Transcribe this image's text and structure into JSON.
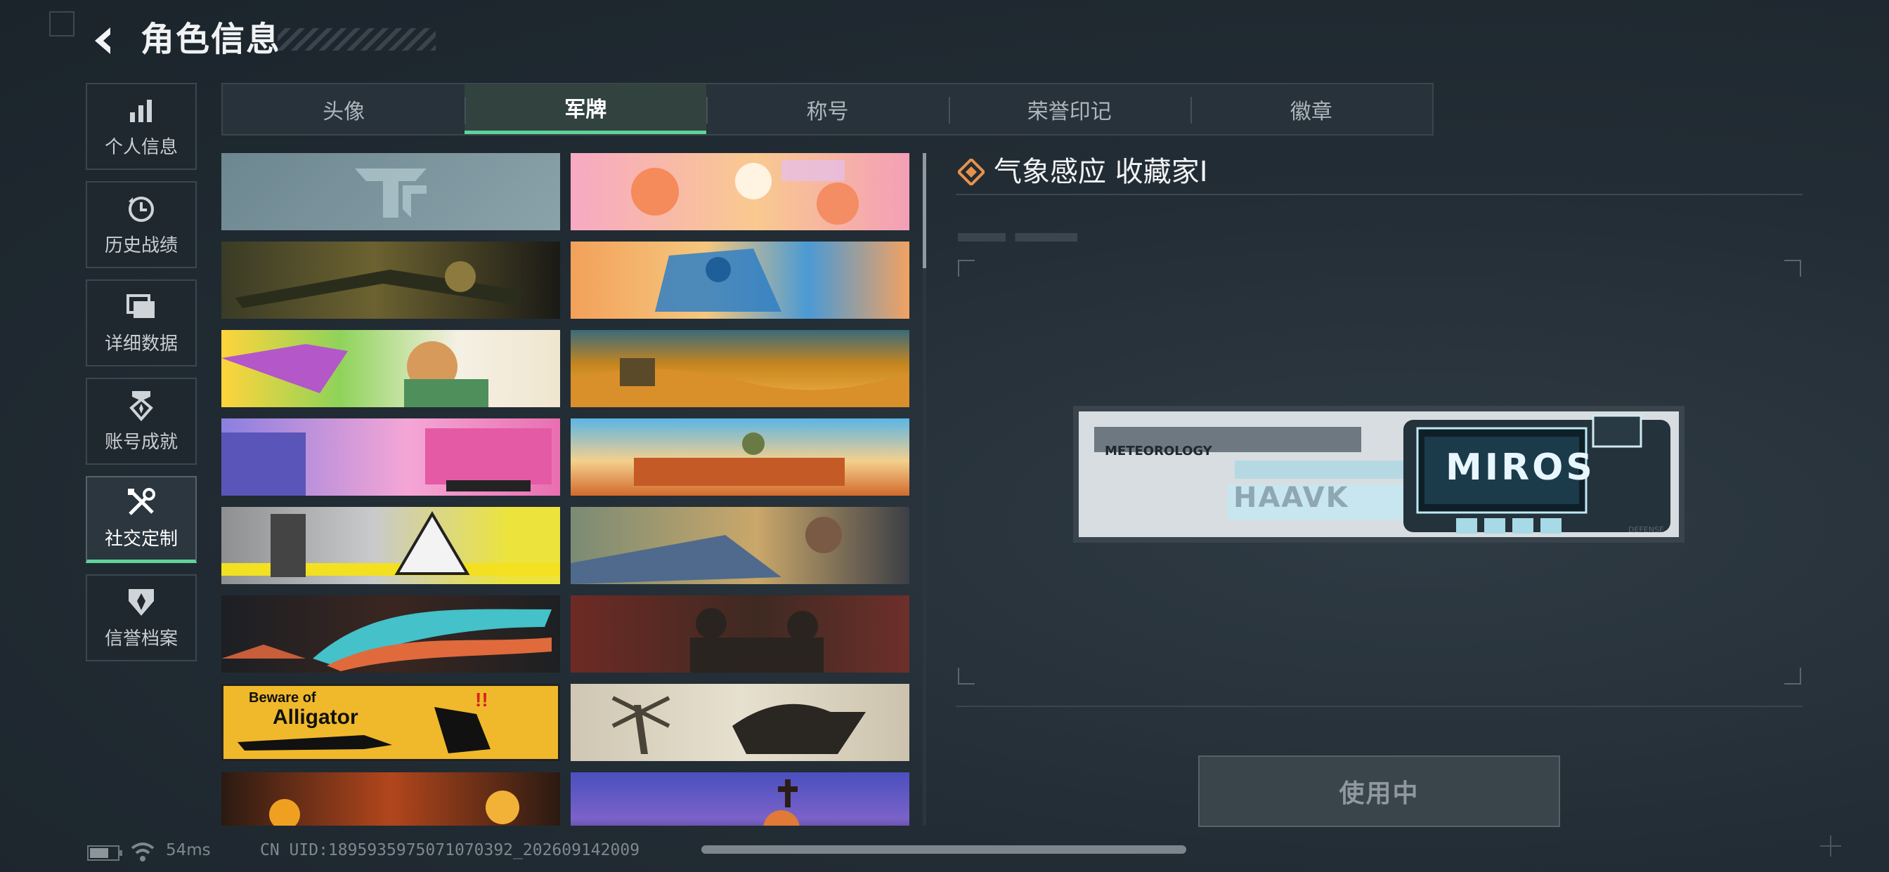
{
  "header": {
    "title": "角色信息"
  },
  "nav": [
    {
      "id": "personal",
      "label": "个人信息",
      "icon": "bar-chart-icon",
      "active": false
    },
    {
      "id": "history",
      "label": "历史战绩",
      "icon": "clock-icon",
      "active": false
    },
    {
      "id": "details",
      "label": "详细数据",
      "icon": "folder-icon",
      "active": false
    },
    {
      "id": "achievements",
      "label": "账号成就",
      "icon": "medal-icon",
      "active": false
    },
    {
      "id": "social",
      "label": "社交定制",
      "icon": "tools-icon",
      "active": true
    },
    {
      "id": "credit",
      "label": "信誉档案",
      "icon": "shield-icon",
      "active": false
    }
  ],
  "tabs": [
    {
      "label": "头像",
      "active": false
    },
    {
      "label": "军牌",
      "active": true
    },
    {
      "label": "称号",
      "active": false
    },
    {
      "label": "荣誉印记",
      "active": false
    },
    {
      "label": "徽章",
      "active": false
    }
  ],
  "detail": {
    "title": "气象感应 收藏家Ⅰ",
    "use_button": "使用中",
    "featured_tag": {
      "brand": "MIROS",
      "maker": "HAAVK",
      "top_text": "METEOROLOGY",
      "side_text": "DEFENSE"
    }
  },
  "tag_texts": {
    "gator_line1": "Beware of",
    "gator_line2": "Alligator",
    "gator_mark": "!!"
  },
  "status": {
    "ping": "54ms",
    "uid": "CN UID:18959359750710703​92_202609142009"
  },
  "colors": {
    "accent": "#5fd39a",
    "background": "#232d35",
    "detail_icon": "#e8914a"
  }
}
